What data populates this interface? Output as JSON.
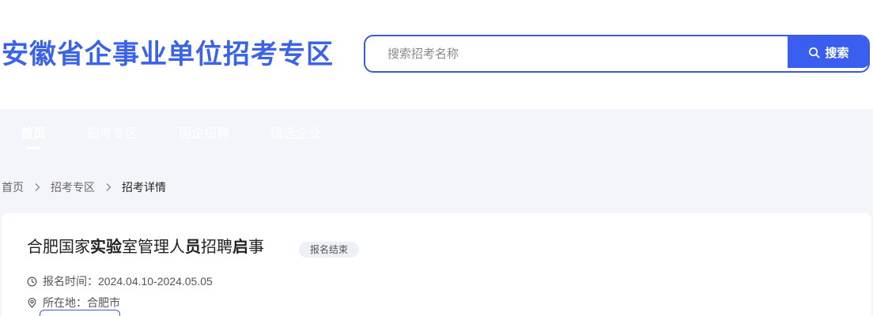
{
  "header": {
    "site_title": "安徽省企事业单位招考专区",
    "search": {
      "placeholder": "搜索招考名称",
      "button_label": "搜索"
    }
  },
  "nav": {
    "items": [
      {
        "label": "首页",
        "active": true
      },
      {
        "label": "招考专区"
      },
      {
        "label": "国企招聘"
      },
      {
        "label": "精选企业"
      }
    ]
  },
  "breadcrumb": {
    "items": [
      "首页",
      "招考专区",
      "招考详情"
    ]
  },
  "job": {
    "title_parts": [
      "合肥国家",
      "实验",
      "室管理人",
      "员",
      "招聘",
      "启",
      "事"
    ],
    "status": "报名结束",
    "period_label": "报名时间：",
    "period_value": "2024.04.10-2024.05.05",
    "location_label": "所在地：",
    "location_value": "合肥市"
  },
  "colors": {
    "brand_blue": "#3a63e8",
    "button_blue": "#3a5ff0",
    "page_bg": "#f3f5fa"
  }
}
